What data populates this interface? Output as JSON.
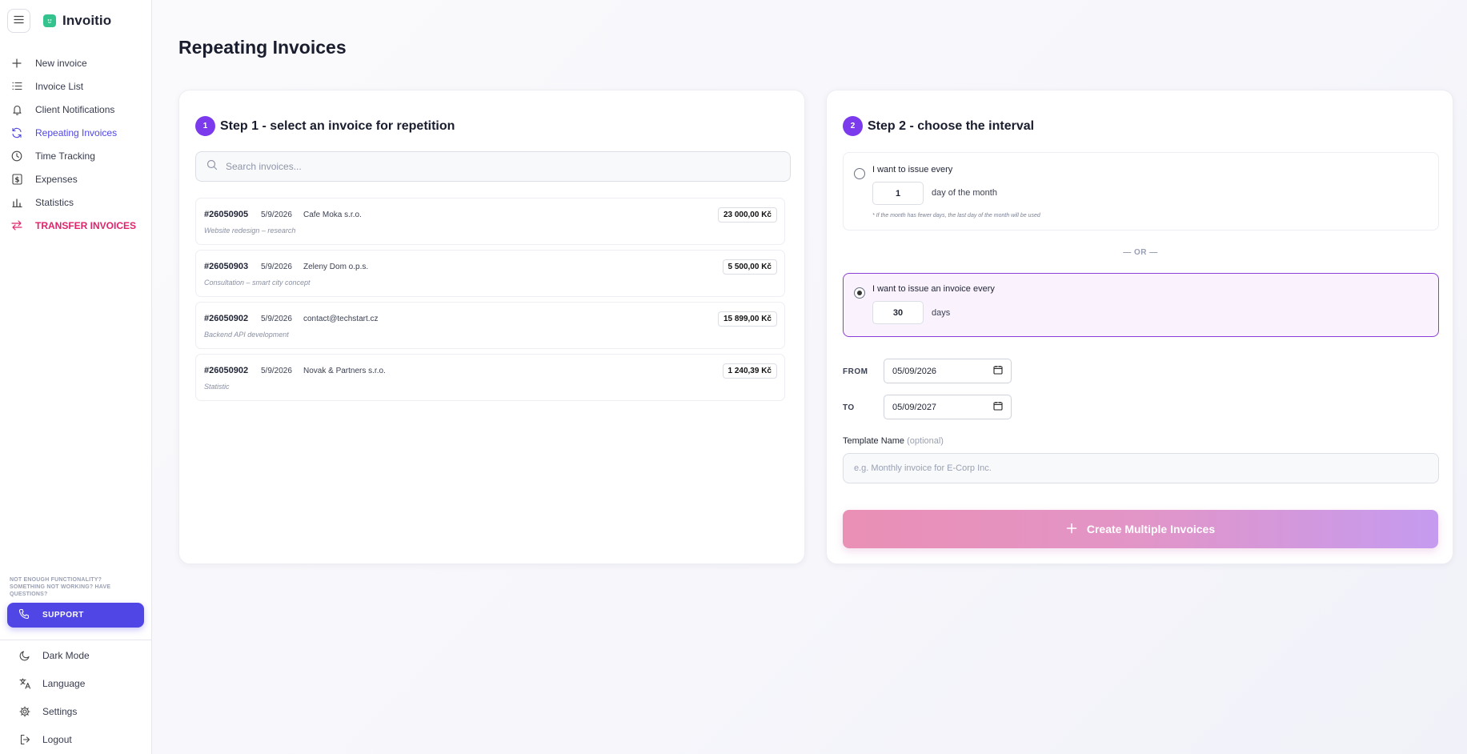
{
  "app": {
    "name": "Invoitio"
  },
  "sidebar": {
    "items": [
      {
        "label": "New invoice",
        "icon": "plus-icon"
      },
      {
        "label": "Invoice List",
        "icon": "list-icon"
      },
      {
        "label": "Client Notifications",
        "icon": "bell-icon"
      },
      {
        "label": "Repeating Invoices",
        "icon": "refresh-icon",
        "active": true
      },
      {
        "label": "Time Tracking",
        "icon": "clock-icon"
      },
      {
        "label": "Expenses",
        "icon": "dollar-icon"
      },
      {
        "label": "Statistics",
        "icon": "bar-chart-icon"
      },
      {
        "label": "TRANSFER INVOICES",
        "icon": "transfer-icon"
      }
    ],
    "help_text": "NOT ENOUGH FUNCTIONALITY? SOMETHING NOT WORKING? HAVE QUESTIONS?",
    "support_label": "SUPPORT",
    "bottom": [
      {
        "label": "Dark Mode",
        "icon": "moon-icon"
      },
      {
        "label": "Language",
        "icon": "translate-icon"
      },
      {
        "label": "Settings",
        "icon": "gear-icon"
      },
      {
        "label": "Logout",
        "icon": "logout-icon"
      }
    ]
  },
  "page": {
    "title": "Repeating Invoices"
  },
  "step1": {
    "number": "1",
    "title": "Step 1 - select an invoice for repetition",
    "search_placeholder": "Search invoices...",
    "invoices": [
      {
        "number": "#26050905",
        "date": "5/9/2026",
        "client": "Cafe Moka s.r.o.",
        "description": "Website redesign – research",
        "amount": "23 000,00 Kč"
      },
      {
        "number": "#26050903",
        "date": "5/9/2026",
        "client": "Zeleny Dom o.p.s.",
        "description": "Consultation – smart city concept",
        "amount": "5 500,00 Kč"
      },
      {
        "number": "#26050902",
        "date": "5/9/2026",
        "client": "contact@techstart.cz",
        "description": "Backend API development",
        "amount": "15 899,00 Kč"
      },
      {
        "number": "#26050902",
        "date": "5/9/2026",
        "client": "Novak & Partners s.r.o.",
        "description": "Statistic",
        "amount": "1 240,39 Kč"
      }
    ]
  },
  "step2": {
    "number": "2",
    "title": "Step 2 - choose the interval",
    "option1": {
      "label": "I want to issue every",
      "value": "1",
      "unit": "day of the month",
      "note": "* If the month has fewer days, the last day of the month will be used",
      "selected": false
    },
    "or_label": "— OR —",
    "option2": {
      "label": "I want to issue an invoice every",
      "value": "30",
      "unit": "days",
      "selected": true
    },
    "from_label": "FROM",
    "from_value": "05/09/2026",
    "to_label": "TO",
    "to_value": "05/09/2027",
    "template_label": "Template Name",
    "template_optional": "(optional)",
    "template_placeholder": "e.g. Monthly invoice for E-Corp Inc.",
    "create_label": "Create Multiple Invoices"
  },
  "colors": {
    "accent": "#4f46e5",
    "step_badge": "#7c3aed",
    "transfer": "#e0246a",
    "selected_border": "#8b3fd6"
  }
}
